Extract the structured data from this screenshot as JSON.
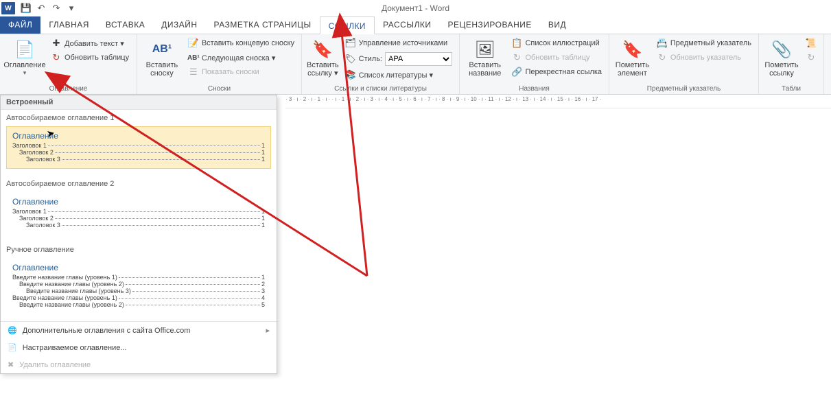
{
  "title": "Документ1 - Word",
  "qat": {
    "save": "💾",
    "undo": "↶",
    "redo": "↷",
    "more": "▾"
  },
  "tabs": {
    "file": "ФАЙЛ",
    "home": "ГЛАВНАЯ",
    "insert": "ВСТАВКА",
    "design": "ДИЗАЙН",
    "layout": "РАЗМЕТКА СТРАНИЦЫ",
    "references": "ССЫЛКИ",
    "mailings": "РАССЫЛКИ",
    "review": "РЕЦЕНЗИРОВАНИЕ",
    "view": "ВИД"
  },
  "ribbon": {
    "toc": {
      "button": "Оглавление",
      "addText": "Добавить текст ▾",
      "updateTable": "Обновить таблицу",
      "groupLabel": "Оглавление"
    },
    "footnotes": {
      "insertFootnote": "Вставить сноску",
      "ab": "AB¹",
      "insertEndnote": "Вставить концевую сноску",
      "nextFootnote": "Следующая сноска ▾",
      "showNotes": "Показать сноски",
      "groupLabel": "Сноски"
    },
    "citations": {
      "insertCitation": "Вставить ссылку ▾",
      "manageSources": "Управление источниками",
      "styleLabel": "Стиль:",
      "styleValue": "APA",
      "bibliography": "Список литературы ▾",
      "groupLabel": "Ссылки и списки литературы"
    },
    "captions": {
      "insertCaption": "Вставить название",
      "listOfFigures": "Список иллюстраций",
      "updateTable": "Обновить таблицу",
      "crossRef": "Перекрестная ссылка",
      "groupLabel": "Названия"
    },
    "index": {
      "markEntry": "Пометить элемент",
      "insertIndex": "Предметный указатель",
      "updateIndex": "Обновить указатель",
      "groupLabel": "Предметный указатель"
    },
    "toa": {
      "markCitation": "Пометить ссылку",
      "groupLabel": "Табли"
    }
  },
  "ruler": "· 3 · ı · 2 · ı · 1 · ı ·  · ı · 1 · ı · 2 · ı · 3 · ı · 4 · ı · 5 · ı · 6 · ı · 7 · ı · 8 · ı · 9 · ı · 10 · ı · 11 · ı · 12 · ı · 13 · ı · 14 · ı · 15 · ı · 16 · ı · 17 ·",
  "tocPanel": {
    "builtIn": "Встроенный",
    "auto1": {
      "title": "Автособираемое оглавление 1",
      "heading": "Оглавление",
      "lines": [
        {
          "lvl": 1,
          "t": "Заголовок 1",
          "p": "1"
        },
        {
          "lvl": 2,
          "t": "Заголовок 2",
          "p": "1"
        },
        {
          "lvl": 3,
          "t": "Заголовок 3",
          "p": "1"
        }
      ]
    },
    "auto2": {
      "title": "Автособираемое оглавление 2",
      "heading": "Оглавление",
      "lines": [
        {
          "lvl": 1,
          "t": "Заголовок 1",
          "p": "1"
        },
        {
          "lvl": 2,
          "t": "Заголовок 2",
          "p": "1"
        },
        {
          "lvl": 3,
          "t": "Заголовок 3",
          "p": "1"
        }
      ]
    },
    "manual": {
      "title": "Ручное оглавление",
      "heading": "Оглавление",
      "lines": [
        {
          "lvl": 1,
          "t": "Введите название главы (уровень 1)",
          "p": "1"
        },
        {
          "lvl": 2,
          "t": "Введите название главы (уровень 2)",
          "p": "2"
        },
        {
          "lvl": 3,
          "t": "Введите название главы (уровень 3)",
          "p": "3"
        },
        {
          "lvl": 1,
          "t": "Введите название главы (уровень 1)",
          "p": "4"
        },
        {
          "lvl": 2,
          "t": "Введите название главы (уровень 2)",
          "p": "5"
        }
      ]
    },
    "footer": {
      "moreOnline": "Дополнительные оглавления с сайта Office.com",
      "custom": "Настраиваемое оглавление...",
      "remove": "Удалить оглавление"
    }
  }
}
